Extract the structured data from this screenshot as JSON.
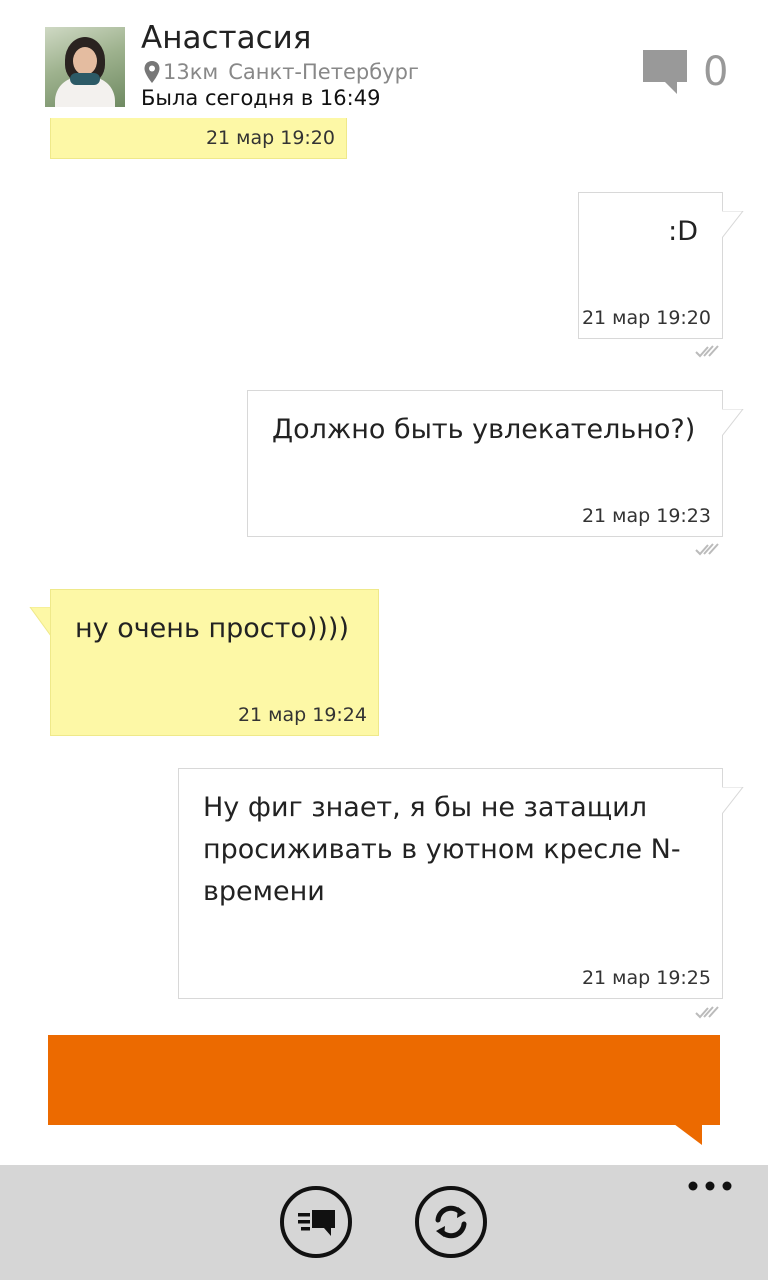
{
  "header": {
    "name": "Анастасия",
    "distance": "13км",
    "city": "Санкт-Петербург",
    "last_seen": "Была сегодня в 16:49",
    "unread_count": "0"
  },
  "messages": [
    {
      "direction": "in",
      "text": "",
      "time": "21 мар 19:20"
    },
    {
      "direction": "out",
      "text": ":D",
      "time": "21 мар 19:20"
    },
    {
      "direction": "out",
      "text": "Должно быть увлекательно?)",
      "time": "21 мар 19:23"
    },
    {
      "direction": "in",
      "text": "ну очень просто))))",
      "time": "21 мар 19:24"
    },
    {
      "direction": "out",
      "text": "Ну фиг знает, я бы не затащил просиживать в уютном кресле N-времени",
      "time": "21 мар 19:25"
    }
  ],
  "compose": {
    "value": ""
  },
  "appbar": {
    "buttons": [
      {
        "icon": "messages-list-icon"
      },
      {
        "icon": "refresh-icon"
      }
    ],
    "more_icon": "more-dots-icon"
  },
  "colors": {
    "accent": "#ec6a00",
    "incoming_bubble": "#fdf8a6",
    "outgoing_bubble": "#ffffff",
    "appbar": "#d6d6d6"
  }
}
